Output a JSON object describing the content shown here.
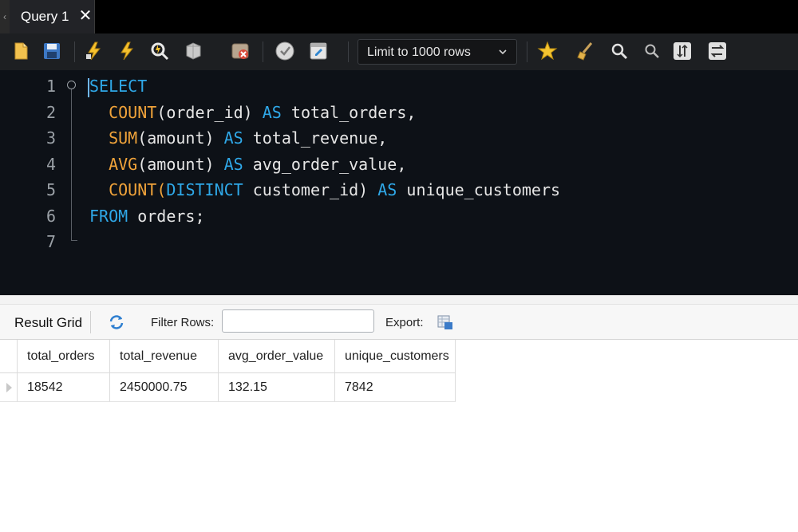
{
  "tabs": [
    {
      "label": "Query 1",
      "close": "✕"
    }
  ],
  "tab_scroll": "‹",
  "toolbar": {
    "icons": [
      "open-file-icon",
      "save-icon",
      "execute-all-icon",
      "execute-current-icon",
      "explain-icon",
      "stop-icon",
      "toggle-error-icon",
      "commit-icon",
      "rollback-icon",
      "beautify-icon",
      "find-icon",
      "find-next-icon",
      "invisible-chars-icon",
      "word-wrap-icon"
    ],
    "limit_select": {
      "value": "Limit to 1000 rows"
    }
  },
  "editor": {
    "lines": [
      {
        "number": "1"
      },
      {
        "number": "2"
      },
      {
        "number": "3"
      },
      {
        "number": "4"
      },
      {
        "number": "5"
      },
      {
        "number": "6"
      },
      {
        "number": "7"
      }
    ],
    "sql": {
      "l1": {
        "kw": "SELECT"
      },
      "l2": {
        "fn": "COUNT",
        "args": "(order_id) ",
        "as": "AS",
        "alias": " total_orders,"
      },
      "l3": {
        "fn": "SUM",
        "args": "(amount) ",
        "as": "AS",
        "alias": " total_revenue,"
      },
      "l4": {
        "fn": "AVG",
        "args": "(amount) ",
        "as": "AS",
        "alias": " avg_order_value,"
      },
      "l5": {
        "fn": "COUNT",
        "open": "(",
        "kw": "DISTINCT",
        "args": " customer_id) ",
        "as": "AS",
        "alias": " unique_customers"
      },
      "l6": {
        "kw": "FROM",
        "rest": " orders;"
      }
    },
    "colors": {
      "keyword": "#2fa8e8",
      "function": "#f0a33a",
      "text": "#e6e6e6",
      "background": "#0d1117"
    }
  },
  "result": {
    "title": "Result Grid",
    "filter_label": "Filter Rows:",
    "filter_value": "",
    "export_label": "Export:",
    "columns": [
      "total_orders",
      "total_revenue",
      "avg_order_value",
      "unique_customers"
    ],
    "rows": [
      [
        "18542",
        "2450000.75",
        "132.15",
        "7842"
      ]
    ]
  }
}
